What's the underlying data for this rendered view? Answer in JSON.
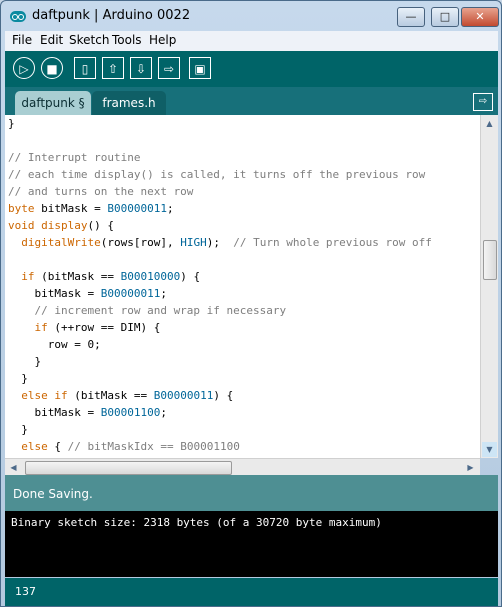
{
  "window": {
    "title": "daftpunk | Arduino 0022",
    "controls": {
      "minimize": "—",
      "maximize": "□",
      "close": "✕"
    }
  },
  "menu": [
    "File",
    "Edit",
    "Sketch",
    "Tools",
    "Help"
  ],
  "toolbar": {
    "run": "▷",
    "stop": "■",
    "new": "▯",
    "open": "⇧",
    "save": "⇩",
    "upload": "⇨",
    "serial_monitor": "▣"
  },
  "tabs": [
    {
      "label": "daftpunk §"
    },
    {
      "label": "frames.h"
    }
  ],
  "tab_menu_icon": "⇨",
  "editor": {
    "lines": [
      "}",
      "",
      "// Interrupt routine",
      "// each time display() is called, it turns off the previous row",
      "// and turns on the next row",
      "byte bitMask = B00000011;",
      "void display() {",
      "  digitalWrite(rows[row], HIGH);  // Turn whole previous row off",
      "",
      "  if (bitMask == B00010000) {",
      "    bitMask = B00000011;",
      "    // increment row and wrap if necessary",
      "    if (++row == DIM) {",
      "      row = 0;",
      "    }",
      "  }",
      "  else if (bitMask == B00000011) {",
      "    bitMask = B00001100;",
      "  }",
      "  else { // bitMaskIdx == B00001100"
    ]
  },
  "scroll": {
    "up": "▲",
    "down": "▼",
    "left": "◀",
    "right": "▶"
  },
  "status": {
    "message": "Done Saving."
  },
  "console": {
    "text": "Binary sketch size: 2318 bytes (of a 30720 byte maximum)"
  },
  "footer": {
    "line_number": "137"
  },
  "colors": {
    "toolbar": "#006468",
    "tabbar": "#17707a",
    "status": "#4e8f93",
    "console": "#000000",
    "comment": "#7e7e7e",
    "keyword": "#cc6600",
    "constant": "#006699"
  }
}
